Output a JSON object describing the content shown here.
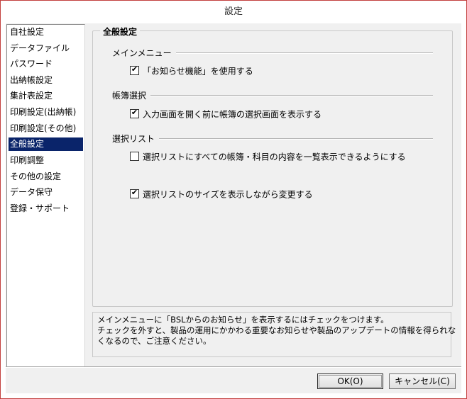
{
  "window": {
    "title": "設定"
  },
  "sidebar": {
    "items": [
      {
        "label": "自社設定",
        "selected": false
      },
      {
        "label": "データファイル",
        "selected": false
      },
      {
        "label": "パスワード",
        "selected": false
      },
      {
        "label": "出納帳設定",
        "selected": false
      },
      {
        "label": "集計表設定",
        "selected": false
      },
      {
        "label": "印刷設定(出納帳)",
        "selected": false
      },
      {
        "label": "印刷設定(その他)",
        "selected": false
      },
      {
        "label": "全般設定",
        "selected": true
      },
      {
        "label": "印刷調整",
        "selected": false
      },
      {
        "label": "その他の設定",
        "selected": false
      },
      {
        "label": "データ保守",
        "selected": false
      },
      {
        "label": "登録・サポート",
        "selected": false
      }
    ]
  },
  "general": {
    "title": "全般設定",
    "main_menu": {
      "label": "メインメニュー",
      "notice_checkbox": {
        "label": "「お知らせ機能」を使用する",
        "checked": true
      }
    },
    "ledger_select": {
      "label": "帳簿選択",
      "selection_screen_checkbox": {
        "label": "入力画面を開く前に帳簿の選択画面を表示する",
        "checked": true
      }
    },
    "select_list": {
      "label": "選択リスト",
      "list_all_checkbox": {
        "label": "選択リストにすべての帳簿・科目の内容を一覧表示できるようにする",
        "checked": false
      },
      "size_checkbox": {
        "label": "選択リストのサイズを表示しながら変更する",
        "checked": true
      }
    }
  },
  "description": {
    "line1": "メインメニューに「BSLからのお知らせ」を表示するにはチェックをつけます。",
    "line2": "チェックを外すと、製品の運用にかかわる重要なお知らせや製品のアップデートの情報を得られな",
    "line3": "くなるので、ご注意ください。"
  },
  "buttons": {
    "ok": "OK(O)",
    "cancel": "キャンセル(C)"
  },
  "colors": {
    "selection": "#0a246a",
    "frame_accent": "#c3403e"
  },
  "icons": {
    "check": "✔"
  }
}
